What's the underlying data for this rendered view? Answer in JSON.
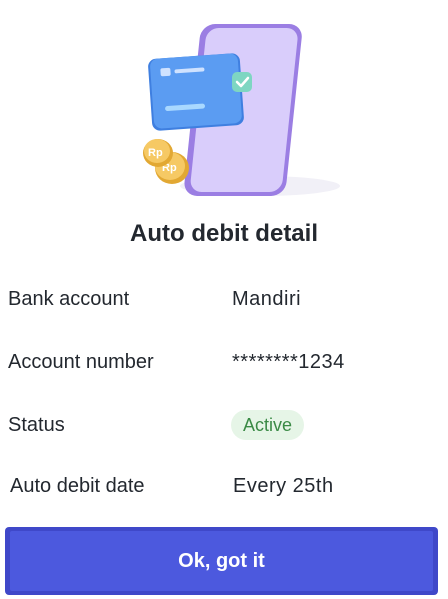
{
  "title": "Auto debit detail",
  "details": {
    "bank_account": {
      "label": "Bank account",
      "value": "Mandiri"
    },
    "account_number": {
      "label": "Account number",
      "value": "********1234"
    },
    "status": {
      "label": "Status",
      "value": "Active",
      "badge_color": "#3a8a45",
      "badge_bg": "#e6f5e7"
    },
    "auto_debit_date": {
      "label": "Auto debit date",
      "value": "Every 25th"
    }
  },
  "illustration": {
    "icons": [
      "phone-icon",
      "credit-card-icon",
      "checkmark-icon",
      "rupiah-coin-icon"
    ],
    "coin_text": "Rp"
  },
  "confirm_button": {
    "label": "Ok, got it",
    "color": "#4c59de"
  }
}
